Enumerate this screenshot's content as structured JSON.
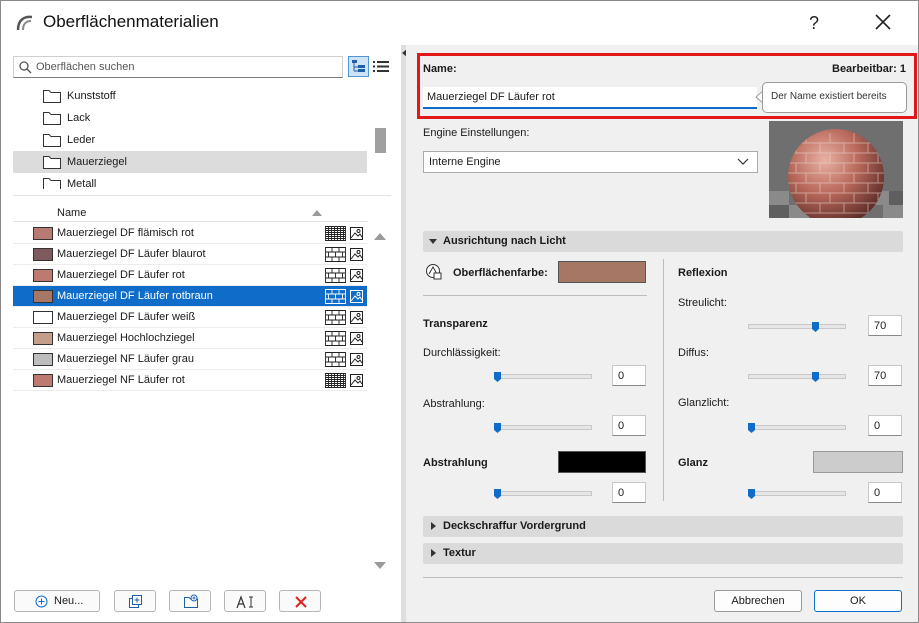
{
  "window": {
    "title": "Oberflächenmaterialien",
    "help": "?"
  },
  "search": {
    "placeholder": "Oberflächen suchen"
  },
  "folders": [
    {
      "label": "Kunststoff"
    },
    {
      "label": "Lack"
    },
    {
      "label": "Leder"
    },
    {
      "label": "Mauerziegel",
      "selected": true
    },
    {
      "label": "Metall"
    }
  ],
  "materials": {
    "header": "Name",
    "rows": [
      {
        "label": "Mauerziegel DF flämisch rot",
        "color": "#b77b74",
        "hatch": "dense"
      },
      {
        "label": "Mauerziegel DF Läufer blaurot",
        "color": "#7e5a5e",
        "hatch": "brick"
      },
      {
        "label": "Mauerziegel DF Läufer rot",
        "color": "#bd7a71",
        "hatch": "brick"
      },
      {
        "label": "Mauerziegel DF Läufer rotbraun",
        "color": "#a77766",
        "hatch": "brick",
        "selected": true
      },
      {
        "label": "Mauerziegel DF Läufer weiß",
        "color": "#ffffff",
        "hatch": "brick"
      },
      {
        "label": "Mauerziegel Hochlochziegel",
        "color": "#c49e8b",
        "hatch": "brick"
      },
      {
        "label": "Mauerziegel NF Läufer grau",
        "color": "#bdbdbd",
        "hatch": "brick"
      },
      {
        "label": "Mauerziegel NF Läufer rot",
        "color": "#bd7a71",
        "hatch": "dense"
      }
    ]
  },
  "tools": {
    "new_label": "Neu..."
  },
  "editor": {
    "name_label": "Name:",
    "editable_label": "Bearbeitbar: 1",
    "name_value": "Mauerziegel DF Läufer rot",
    "name_tooltip": "Der Name existiert bereits",
    "engine_label": "Engine Einstellungen:",
    "engine_value": "Interne Engine",
    "section_light": "Ausrichtung nach Licht",
    "surface_color_label": "Oberflächenfarbe:",
    "surface_color": "#a77766",
    "transparency_label": "Transparenz",
    "permeability_label": "Durchlässigkeit:",
    "permeability_value": "0",
    "emission1_label": "Abstrahlung:",
    "emission1_value": "0",
    "emission2_label": "Abstrahlung",
    "emission2_value": "0",
    "emission_color": "#000000",
    "reflection_label": "Reflexion",
    "ambient_label": "Streulicht:",
    "ambient_value": "70",
    "diffuse_label": "Diffus:",
    "diffuse_value": "70",
    "specular_label": "Glanzlicht:",
    "specular_value": "0",
    "gloss_label": "Glanz",
    "gloss_value": "0",
    "gloss_color": "#cccccc",
    "section_hatch": "Deckschraffur Vordergrund",
    "section_texture": "Textur"
  },
  "slider_levels": {
    "permeability": 0,
    "emission1": 0,
    "emission2": 0,
    "ambient": 70,
    "diffuse": 70,
    "specular": 0,
    "gloss": 0
  },
  "buttons": {
    "cancel": "Abbrechen",
    "ok": "OK"
  },
  "colors": {
    "accent": "#0f6dc9",
    "alert": "#e01818"
  }
}
